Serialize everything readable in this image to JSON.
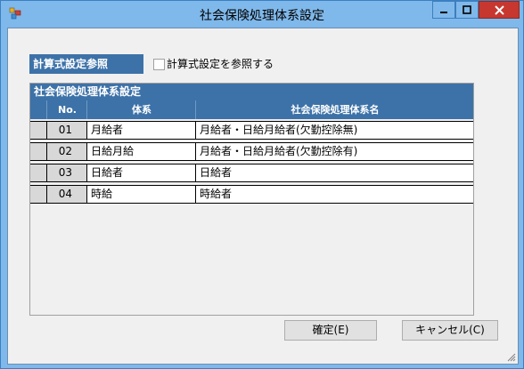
{
  "window": {
    "title": "社会保険処理体系設定"
  },
  "reference": {
    "label": "計算式設定参照",
    "checkbox_label": "計算式設定を参照する",
    "checked": false
  },
  "panel": {
    "title": "社会保険処理体系設定",
    "columns": {
      "no": "No.",
      "type": "体系",
      "name": "社会保険処理体系名"
    },
    "rows": [
      {
        "no": "01",
        "type": "月給者",
        "name": "月給者・日給月給者(欠勤控除無)"
      },
      {
        "no": "02",
        "type": "日給月給",
        "name": "月給者・日給月給者(欠勤控除有)"
      },
      {
        "no": "03",
        "type": "日給者",
        "name": "日給者"
      },
      {
        "no": "04",
        "type": "時給",
        "name": "時給者"
      }
    ]
  },
  "buttons": {
    "ok": "確定(E)",
    "cancel": "キャンセル(C)"
  }
}
